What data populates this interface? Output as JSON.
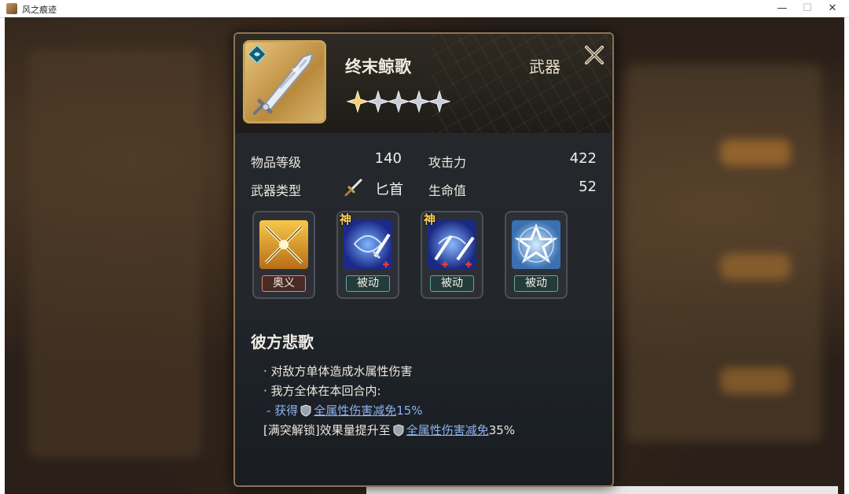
{
  "window": {
    "title": "风之痕迹",
    "minimize": "—",
    "maximize": "☐",
    "close": "✕"
  },
  "item": {
    "name": "终末鲸歌",
    "type": "武器",
    "stars": {
      "filled": 1,
      "total": 5
    },
    "element_icon": "water-element-icon",
    "art_icon": "greatsword-icon"
  },
  "stats": {
    "level_label": "物品等级",
    "level_value": "140",
    "weapon_type_label": "武器类型",
    "weapon_type_value": "匕首",
    "attack_label": "攻击力",
    "attack_value": "422",
    "hp_label": "生命值",
    "hp_value": "52"
  },
  "skills": [
    {
      "tag": "奥义",
      "kind": "ultimate",
      "god": ""
    },
    {
      "tag": "被动",
      "kind": "passive",
      "god": "神"
    },
    {
      "tag": "被动",
      "kind": "passive",
      "god": "神"
    },
    {
      "tag": "被动",
      "kind": "passive",
      "god": ""
    }
  ],
  "description": {
    "skill_name": "彼方悲歌",
    "line1": "· 对敌方单体造成水属性伤害",
    "line2": "· 我方全体在本回合内:",
    "line3_prefix": "- 获得",
    "line3_link": "全属性伤害减免",
    "line3_value": "15%",
    "line4_prefix": "[满突解锁]效果量提升至",
    "line4_link": "全属性伤害减免",
    "line4_value": "35%"
  },
  "colors": {
    "gold_border": "#c9a25a",
    "highlight": "#8db1ea",
    "panel_bg": "#23272c"
  }
}
